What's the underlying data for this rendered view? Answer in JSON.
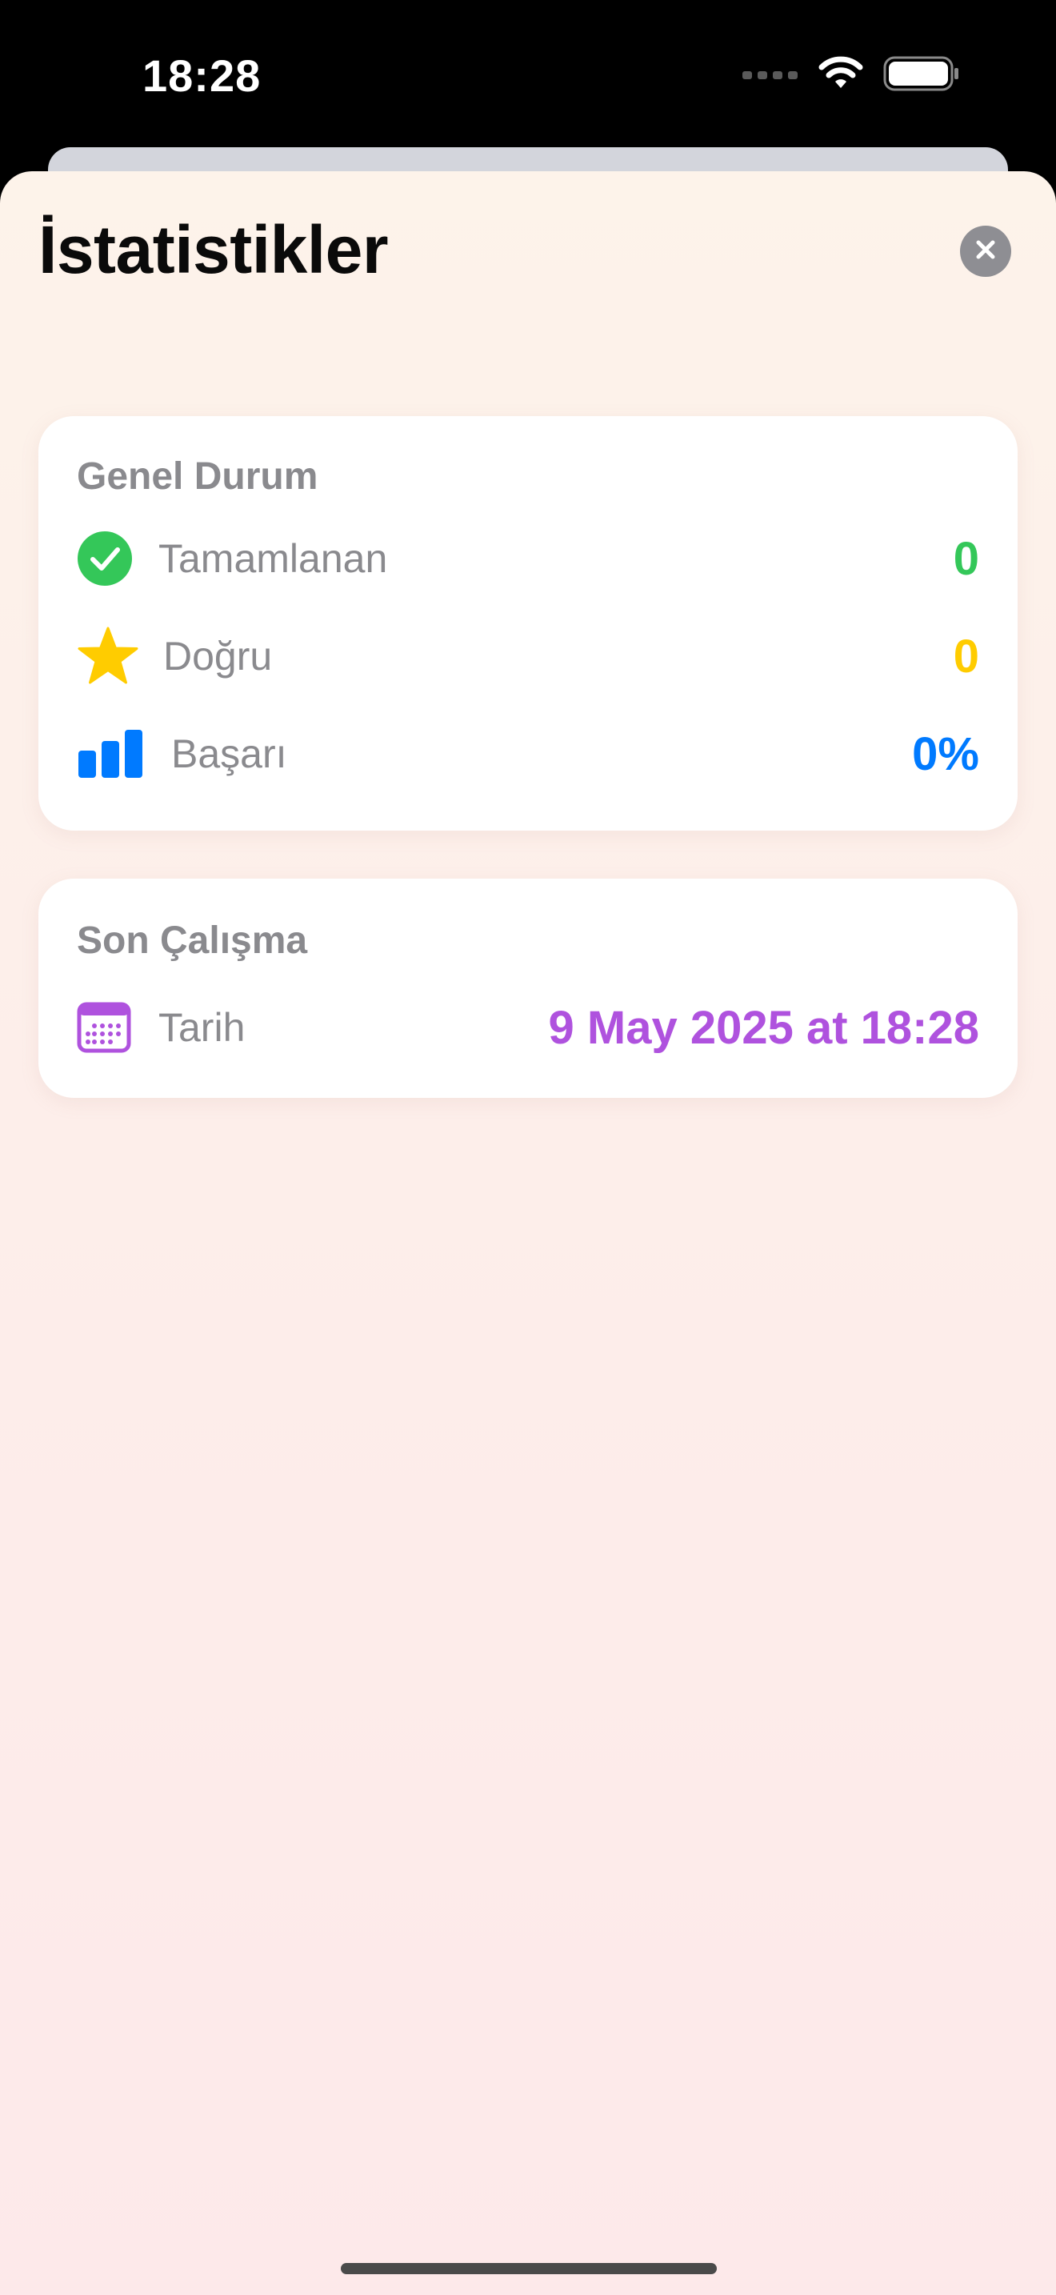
{
  "status_bar": {
    "time": "18:28"
  },
  "sheet": {
    "title": "İstatistikler",
    "close_icon": "xmark-circle-icon"
  },
  "general": {
    "heading": "Genel Durum",
    "rows": [
      {
        "icon": "checkmark-circle-icon",
        "label": "Tamamlanan",
        "value": "0",
        "color": "#34c759"
      },
      {
        "icon": "star-icon",
        "label": "Doğru",
        "value": "0",
        "color": "#ffcc00"
      },
      {
        "icon": "bar-chart-icon",
        "label": "Başarı",
        "value": "0%",
        "color": "#007aff"
      }
    ]
  },
  "last_session": {
    "heading": "Son Çalışma",
    "rows": [
      {
        "icon": "calendar-icon",
        "label": "Tarih",
        "value": "9 May 2025 at 18:28",
        "color": "#af52de"
      }
    ]
  }
}
